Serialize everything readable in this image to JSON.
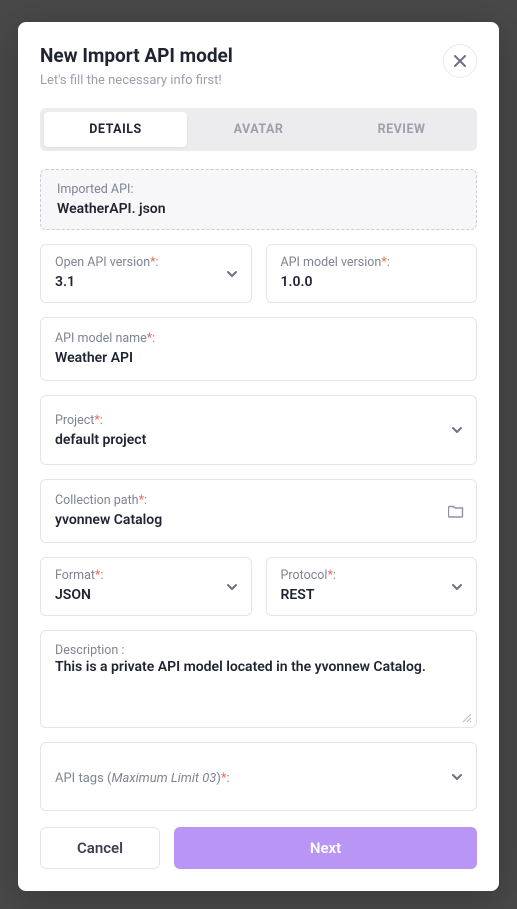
{
  "modal": {
    "title": "New Import API model",
    "subtitle": "Let's fill the necessary info first!"
  },
  "tabs": {
    "details": "DETAILS",
    "avatar": "AVATAR",
    "review": "REVIEW"
  },
  "imported": {
    "label": "Imported API:",
    "value": "WeatherAPI. json"
  },
  "openapi": {
    "label": "Open API version",
    "value": "3.1"
  },
  "modelversion": {
    "label": "API model version",
    "value": "1.0.0"
  },
  "modelname": {
    "label": "API model name",
    "value": "Weather API"
  },
  "project": {
    "label": "Project",
    "value": "default project"
  },
  "collection": {
    "label": "Collection path",
    "value": "yvonnew Catalog"
  },
  "format": {
    "label": "Format",
    "value": "JSON"
  },
  "protocol": {
    "label": "Protocol",
    "value": "REST"
  },
  "description": {
    "label": "Description :",
    "value": "This is a private API model located in the yvonnew Catalog."
  },
  "tags": {
    "label_prefix": "API tags (",
    "label_limit": "Maximum Limit 03",
    "label_suffix": ")"
  },
  "buttons": {
    "cancel": "Cancel",
    "next": "Next"
  }
}
